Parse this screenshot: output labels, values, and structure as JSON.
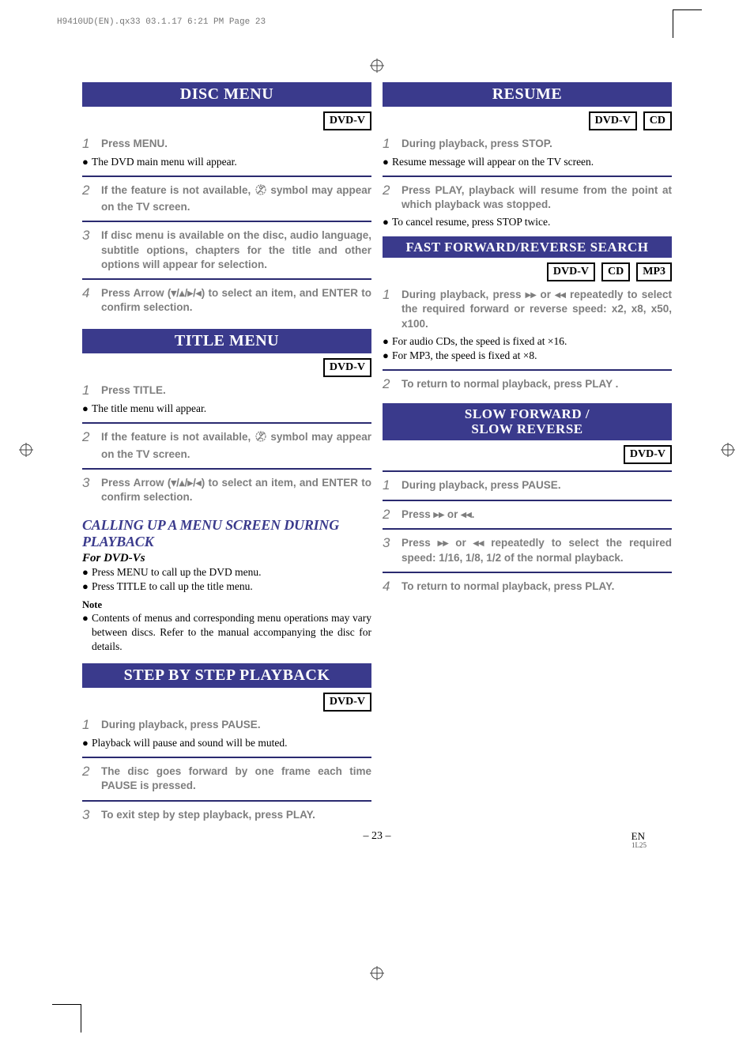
{
  "print_header": "H9410UD(EN).qx33  03.1.17  6:21 PM  Page 23",
  "badges": {
    "dvdv": "DVD-V",
    "cd": "CD",
    "mp3": "MP3"
  },
  "page_number": "– 23 –",
  "page_lang": "EN",
  "page_code": "1L25",
  "left": {
    "disc_menu": {
      "title": "DISC MENU",
      "s1": "Press MENU.",
      "b1": "The DVD main menu will appear.",
      "s2a": "If the feature is not available, ",
      "s2b": " symbol may appear on the TV screen.",
      "s3": "If disc menu is available on the disc, audio language, subtitle options, chapters for the title and other options will appear for selection.",
      "s4": "Press Arrow (▾/▴/▸/◂) to select an item, and ENTER to confirm selection."
    },
    "title_menu": {
      "title": "TITLE MENU",
      "s1": "Press TITLE.",
      "b1": "The title menu will appear.",
      "s2a": "If the feature is not available, ",
      "s2b": " symbol may appear on the TV screen.",
      "s3": "Press Arrow (▾/▴/▸/◂) to select an item, and ENTER to confirm selection."
    },
    "calling": {
      "h1": "CALLING UP A MENU SCREEN DURING PLAYBACK",
      "h2": "For DVD-Vs",
      "b1": "Press MENU to call up the DVD menu.",
      "b2": "Press TITLE to call up the title menu.",
      "note_label": "Note",
      "note": "Contents of menus and corresponding menu operations may vary between discs. Refer to the manual accompanying the disc for details."
    },
    "step_play": {
      "title": "STEP BY STEP PLAYBACK",
      "s1": "During playback, press PAUSE.",
      "b1": "Playback will pause and sound will be muted.",
      "s2": "The disc goes forward by one frame each time PAUSE is pressed.",
      "s3": "To exit step by step playback, press PLAY."
    }
  },
  "right": {
    "resume": {
      "title": "RESUME",
      "s1": "During playback, press STOP.",
      "b1": "Resume message will appear on the TV screen.",
      "s2": "Press PLAY, playback will resume from the point at which playback was stopped.",
      "b2": "To cancel resume, press STOP twice."
    },
    "ffrev": {
      "title": "FAST FORWARD/REVERSE SEARCH",
      "s1": "During playback, press ▸▸ or ◂◂ repeatedly to select the required forward or reverse speed: x2, x8, x50, x100.",
      "b1": "For audio CDs, the speed is fixed at ×16.",
      "b2": "For MP3, the speed is fixed at ×8.",
      "s2": "To return to normal playback, press PLAY ."
    },
    "slow": {
      "title1": "SLOW FORWARD /",
      "title2": "SLOW REVERSE",
      "s1": "During playback, press PAUSE.",
      "s2": "Press ▸▸ or ◂◂.",
      "s3": "Press ▸▸ or ◂◂ repeatedly to select the required speed: 1/16, 1/8, 1/2 of the normal playback.",
      "s4": "To return to normal playback, press PLAY."
    }
  }
}
